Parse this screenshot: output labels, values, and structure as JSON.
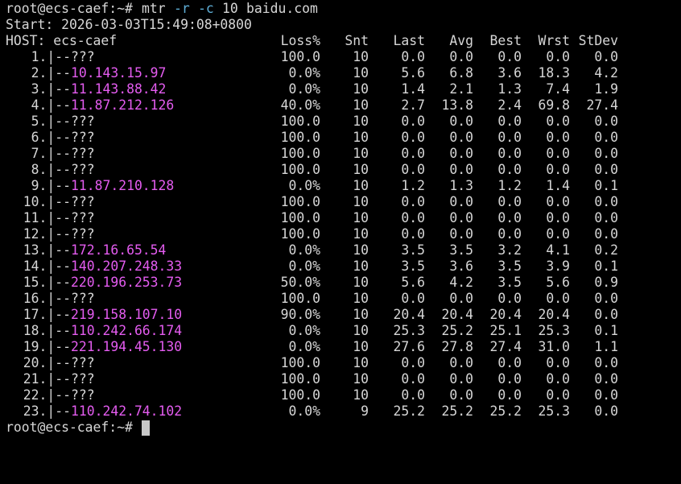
{
  "colors": {
    "background": "#000000",
    "foreground": "#d6d6d6",
    "option": "#5fafd7",
    "host_ip": "#e45cf0",
    "cursor": "#c8c8c8"
  },
  "command": {
    "prompt": "root@ecs-caef:~#",
    "program": "mtr",
    "flag_r": "-r",
    "flag_c": "-c",
    "count": "10",
    "target": "baidu.com"
  },
  "start_line": "Start: 2026-03-03T15:49:08+0800",
  "header": {
    "host": "HOST: ecs-caef",
    "loss": "Loss%",
    "snt": "Snt",
    "last": "Last",
    "avg": "Avg",
    "best": "Best",
    "wrst": "Wrst",
    "stdev": "StDev"
  },
  "hops": [
    {
      "num": "1.|--",
      "host": "???",
      "unknown": true,
      "loss": "100.0",
      "snt": "10",
      "last": "0.0",
      "avg": "0.0",
      "best": "0.0",
      "wrst": "0.0",
      "stdev": "0.0"
    },
    {
      "num": "2.|--",
      "host": "10.143.15.97",
      "unknown": false,
      "loss": "0.0%",
      "snt": "10",
      "last": "5.6",
      "avg": "6.8",
      "best": "3.6",
      "wrst": "18.3",
      "stdev": "4.2"
    },
    {
      "num": "3.|--",
      "host": "11.143.88.42",
      "unknown": false,
      "loss": "0.0%",
      "snt": "10",
      "last": "1.4",
      "avg": "2.1",
      "best": "1.3",
      "wrst": "7.4",
      "stdev": "1.9"
    },
    {
      "num": "4.|--",
      "host": "11.87.212.126",
      "unknown": false,
      "loss": "40.0%",
      "snt": "10",
      "last": "2.7",
      "avg": "13.8",
      "best": "2.4",
      "wrst": "69.8",
      "stdev": "27.4"
    },
    {
      "num": "5.|--",
      "host": "???",
      "unknown": true,
      "loss": "100.0",
      "snt": "10",
      "last": "0.0",
      "avg": "0.0",
      "best": "0.0",
      "wrst": "0.0",
      "stdev": "0.0"
    },
    {
      "num": "6.|--",
      "host": "???",
      "unknown": true,
      "loss": "100.0",
      "snt": "10",
      "last": "0.0",
      "avg": "0.0",
      "best": "0.0",
      "wrst": "0.0",
      "stdev": "0.0"
    },
    {
      "num": "7.|--",
      "host": "???",
      "unknown": true,
      "loss": "100.0",
      "snt": "10",
      "last": "0.0",
      "avg": "0.0",
      "best": "0.0",
      "wrst": "0.0",
      "stdev": "0.0"
    },
    {
      "num": "8.|--",
      "host": "???",
      "unknown": true,
      "loss": "100.0",
      "snt": "10",
      "last": "0.0",
      "avg": "0.0",
      "best": "0.0",
      "wrst": "0.0",
      "stdev": "0.0"
    },
    {
      "num": "9.|--",
      "host": "11.87.210.128",
      "unknown": false,
      "loss": "0.0%",
      "snt": "10",
      "last": "1.2",
      "avg": "1.3",
      "best": "1.2",
      "wrst": "1.4",
      "stdev": "0.1"
    },
    {
      "num": "10.|--",
      "host": "???",
      "unknown": true,
      "loss": "100.0",
      "snt": "10",
      "last": "0.0",
      "avg": "0.0",
      "best": "0.0",
      "wrst": "0.0",
      "stdev": "0.0"
    },
    {
      "num": "11.|--",
      "host": "???",
      "unknown": true,
      "loss": "100.0",
      "snt": "10",
      "last": "0.0",
      "avg": "0.0",
      "best": "0.0",
      "wrst": "0.0",
      "stdev": "0.0"
    },
    {
      "num": "12.|--",
      "host": "???",
      "unknown": true,
      "loss": "100.0",
      "snt": "10",
      "last": "0.0",
      "avg": "0.0",
      "best": "0.0",
      "wrst": "0.0",
      "stdev": "0.0"
    },
    {
      "num": "13.|--",
      "host": "172.16.65.54",
      "unknown": false,
      "loss": "0.0%",
      "snt": "10",
      "last": "3.5",
      "avg": "3.5",
      "best": "3.2",
      "wrst": "4.1",
      "stdev": "0.2"
    },
    {
      "num": "14.|--",
      "host": "140.207.248.33",
      "unknown": false,
      "loss": "0.0%",
      "snt": "10",
      "last": "3.5",
      "avg": "3.6",
      "best": "3.5",
      "wrst": "3.9",
      "stdev": "0.1"
    },
    {
      "num": "15.|--",
      "host": "220.196.253.73",
      "unknown": false,
      "loss": "50.0%",
      "snt": "10",
      "last": "5.6",
      "avg": "4.2",
      "best": "3.5",
      "wrst": "5.6",
      "stdev": "0.9"
    },
    {
      "num": "16.|--",
      "host": "???",
      "unknown": true,
      "loss": "100.0",
      "snt": "10",
      "last": "0.0",
      "avg": "0.0",
      "best": "0.0",
      "wrst": "0.0",
      "stdev": "0.0"
    },
    {
      "num": "17.|--",
      "host": "219.158.107.10",
      "unknown": false,
      "loss": "90.0%",
      "snt": "10",
      "last": "20.4",
      "avg": "20.4",
      "best": "20.4",
      "wrst": "20.4",
      "stdev": "0.0"
    },
    {
      "num": "18.|--",
      "host": "110.242.66.174",
      "unknown": false,
      "loss": "0.0%",
      "snt": "10",
      "last": "25.3",
      "avg": "25.2",
      "best": "25.1",
      "wrst": "25.3",
      "stdev": "0.1"
    },
    {
      "num": "19.|--",
      "host": "221.194.45.130",
      "unknown": false,
      "loss": "0.0%",
      "snt": "10",
      "last": "27.6",
      "avg": "27.8",
      "best": "27.4",
      "wrst": "31.0",
      "stdev": "1.1"
    },
    {
      "num": "20.|--",
      "host": "???",
      "unknown": true,
      "loss": "100.0",
      "snt": "10",
      "last": "0.0",
      "avg": "0.0",
      "best": "0.0",
      "wrst": "0.0",
      "stdev": "0.0"
    },
    {
      "num": "21.|--",
      "host": "???",
      "unknown": true,
      "loss": "100.0",
      "snt": "10",
      "last": "0.0",
      "avg": "0.0",
      "best": "0.0",
      "wrst": "0.0",
      "stdev": "0.0"
    },
    {
      "num": "22.|--",
      "host": "???",
      "unknown": true,
      "loss": "100.0",
      "snt": "10",
      "last": "0.0",
      "avg": "0.0",
      "best": "0.0",
      "wrst": "0.0",
      "stdev": "0.0"
    },
    {
      "num": "23.|--",
      "host": "110.242.74.102",
      "unknown": false,
      "loss": "0.0%",
      "snt": "9",
      "last": "25.2",
      "avg": "25.2",
      "best": "25.2",
      "wrst": "25.3",
      "stdev": "0.0"
    }
  ],
  "final_prompt": "root@ecs-caef:~#"
}
